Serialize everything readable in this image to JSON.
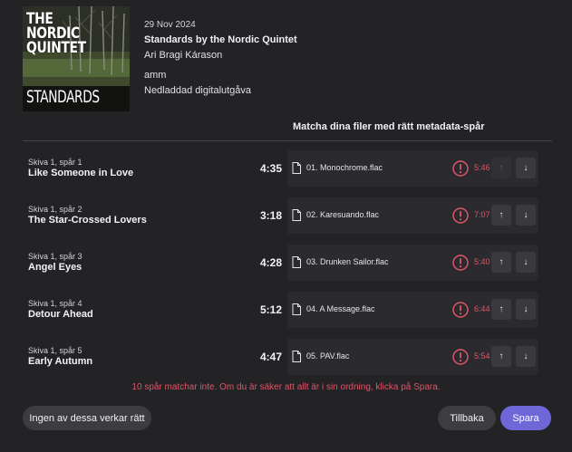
{
  "album": {
    "cover": {
      "title_lines": [
        "THE",
        "NORDIC",
        "QUINTET"
      ],
      "subtitle": "STANDARDS"
    },
    "date": "29 Nov 2024",
    "title": "Standards by the Nordic Quintet",
    "artist": "Ari Bragi Kárason",
    "label": "amm",
    "format": "Nedladdad digitalutgåva"
  },
  "match_header": "Matcha dina filer med rätt metadata-spår",
  "tracks": [
    {
      "position": "Skiva 1, spår 1",
      "name": "Like Someone in Love",
      "duration": "4:35",
      "file": "01. Monochrome.flac",
      "file_duration": "5:46",
      "up_enabled": false
    },
    {
      "position": "Skiva 1, spår 2",
      "name": "The Star-Crossed Lovers",
      "duration": "3:18",
      "file": "02. Karesuando.flac",
      "file_duration": "7:07",
      "up_enabled": true
    },
    {
      "position": "Skiva 1, spår 3",
      "name": "Angel Eyes",
      "duration": "4:28",
      "file": "03. Drunken Sailor.flac",
      "file_duration": "5:40",
      "up_enabled": true
    },
    {
      "position": "Skiva 1, spår 4",
      "name": "Detour Ahead",
      "duration": "5:12",
      "file": "04. A Message.flac",
      "file_duration": "6:44",
      "up_enabled": true
    },
    {
      "position": "Skiva 1, spår 5",
      "name": "Early Autumn",
      "duration": "4:47",
      "file": "05. PAV.flac",
      "file_duration": "5:54",
      "up_enabled": true
    }
  ],
  "icons": {
    "file": "file-icon",
    "warning": "warning-circle-icon",
    "up": "arrow-up-icon",
    "down": "arrow-down-icon"
  },
  "colors": {
    "accent": "#6f67d8",
    "warning": "#e05569",
    "background": "#232225"
  },
  "warning_message": "10 spår matchar inte. Om du är säker att allt är i sin ordning, klicka på Spara.",
  "buttons": {
    "none_match": "Ingen av dessa verkar rätt",
    "back": "Tillbaka",
    "save": "Spara"
  }
}
